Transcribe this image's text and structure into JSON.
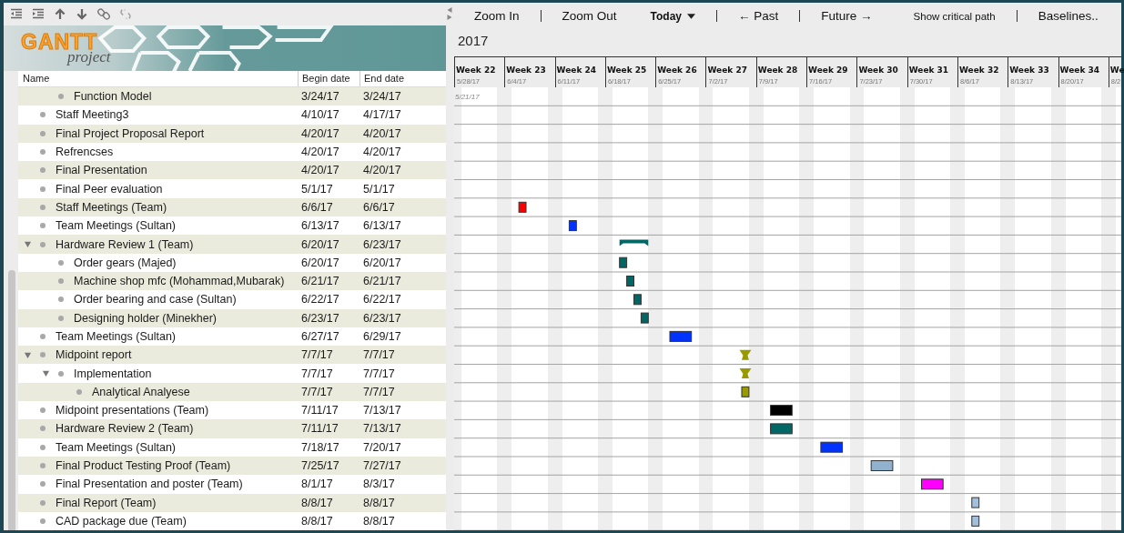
{
  "logo": {
    "title": "GANTT",
    "subtitle": "project"
  },
  "toolbar": [
    {
      "kind": "button",
      "label": "Zoom In"
    },
    {
      "kind": "separator"
    },
    {
      "kind": "button",
      "label": "Zoom Out"
    },
    {
      "kind": "dropdown",
      "label": "Today"
    },
    {
      "kind": "separator"
    },
    {
      "kind": "button",
      "label": "← Past"
    },
    {
      "kind": "separator"
    },
    {
      "kind": "button",
      "label": "Future →"
    },
    {
      "kind": "small",
      "label": "Show critical path"
    },
    {
      "kind": "separator"
    },
    {
      "kind": "button",
      "label": "Baselines.."
    }
  ],
  "table": {
    "columns": [
      "Name",
      "Begin date",
      "End date"
    ],
    "continued_children": [
      {
        "name": "Function Model",
        "begin": "3/24/17",
        "end": "3/24/17"
      }
    ],
    "tasks": [
      {
        "name": "Staff Meeting3",
        "begin": "4/10/17",
        "end": "4/17/17"
      },
      {
        "name": "Final Project Proposal Report",
        "begin": "4/20/17",
        "end": "4/20/17"
      },
      {
        "name": "Refrencses",
        "begin": "4/20/17",
        "end": "4/20/17"
      },
      {
        "name": "Final Presentation",
        "begin": "4/20/17",
        "end": "4/20/17"
      },
      {
        "name": "Final Peer evaluation",
        "begin": "5/1/17",
        "end": "5/1/17"
      },
      {
        "name": "Staff Meetings (Team)",
        "begin": "6/6/17",
        "end": "6/6/17",
        "kind": "task",
        "color": "#ff0000"
      },
      {
        "name": "Team Meetings (Sultan)",
        "begin": "6/13/17",
        "end": "6/13/17",
        "kind": "task",
        "color": "#0033ff"
      },
      {
        "name": "Hardware Review 1 (Team)",
        "begin": "6/20/17",
        "end": "6/23/17",
        "kind": "summary",
        "color": "#006666",
        "expanded": true,
        "children": [
          {
            "name": "Order gears (Majed)",
            "begin": "6/20/17",
            "end": "6/20/17",
            "kind": "task",
            "color": "#006666"
          },
          {
            "name": "Machine shop mfc (Mohammad,Mubarak)",
            "begin": "6/21/17",
            "end": "6/21/17",
            "kind": "task",
            "color": "#006666"
          },
          {
            "name": "Order bearing and case (Sultan)",
            "begin": "6/22/17",
            "end": "6/22/17",
            "kind": "task",
            "color": "#006666"
          },
          {
            "name": "Designing holder (Minekher)",
            "begin": "6/23/17",
            "end": "6/23/17",
            "kind": "task",
            "color": "#006666"
          }
        ]
      },
      {
        "name": "Team Meetings (Sultan)",
        "begin": "6/27/17",
        "end": "6/29/17",
        "kind": "task",
        "color": "#0033ff"
      },
      {
        "name": "Midpoint report",
        "begin": "7/7/17",
        "end": "7/7/17",
        "kind": "milestone",
        "color": "#999900",
        "expanded": true,
        "children": [
          {
            "name": "Implementation",
            "begin": "7/7/17",
            "end": "7/7/17",
            "kind": "milestone",
            "color": "#999900",
            "expanded": true,
            "children": [
              {
                "name": "Analytical Analyese",
                "begin": "7/7/17",
                "end": "7/7/17",
                "kind": "task",
                "color": "#999900"
              }
            ]
          }
        ]
      },
      {
        "name": "Midpoint presentations (Team)",
        "begin": "7/11/17",
        "end": "7/13/17",
        "kind": "task",
        "color": "#000000"
      },
      {
        "name": "Hardware Review 2 (Team)",
        "begin": "7/11/17",
        "end": "7/13/17",
        "kind": "task",
        "color": "#006666"
      },
      {
        "name": "Team Meetings (Sultan)",
        "begin": "7/18/17",
        "end": "7/20/17",
        "kind": "task",
        "color": "#0033ff"
      },
      {
        "name": "Final Product Testing Proof (Team)",
        "begin": "7/25/17",
        "end": "7/27/17",
        "kind": "task",
        "color": "#91b2cf"
      },
      {
        "name": "Final Presentation and poster (Team)",
        "begin": "8/1/17",
        "end": "8/3/17",
        "kind": "task",
        "color": "#ff00ff"
      },
      {
        "name": "Final Report (Team)",
        "begin": "8/8/17",
        "end": "8/8/17",
        "kind": "task",
        "color": "#a3bfd9"
      },
      {
        "name": "CAD package due (Team)",
        "begin": "8/8/17",
        "end": "8/8/17",
        "kind": "task",
        "color": "#a3bfd9"
      }
    ]
  },
  "chart": {
    "year": "2017",
    "start_label": "5/21/17",
    "weeks": [
      {
        "label": "Week 22",
        "date": "5/28/17"
      },
      {
        "label": "Week 23",
        "date": "6/4/17"
      },
      {
        "label": "Week 24",
        "date": "6/11/17"
      },
      {
        "label": "Week 25",
        "date": "6/18/17"
      },
      {
        "label": "Week 26",
        "date": "6/25/17"
      },
      {
        "label": "Week 27",
        "date": "7/2/17"
      },
      {
        "label": "Week 28",
        "date": "7/9/17"
      },
      {
        "label": "Week 29",
        "date": "7/16/17"
      },
      {
        "label": "Week 30",
        "date": "7/23/17"
      },
      {
        "label": "Week 31",
        "date": "7/30/17"
      },
      {
        "label": "Week 32",
        "date": "8/6/17"
      },
      {
        "label": "Week 33",
        "date": "8/13/17"
      },
      {
        "label": "Week 34",
        "date": "8/20/17"
      },
      {
        "label": "We",
        "date": "8/2"
      }
    ]
  }
}
